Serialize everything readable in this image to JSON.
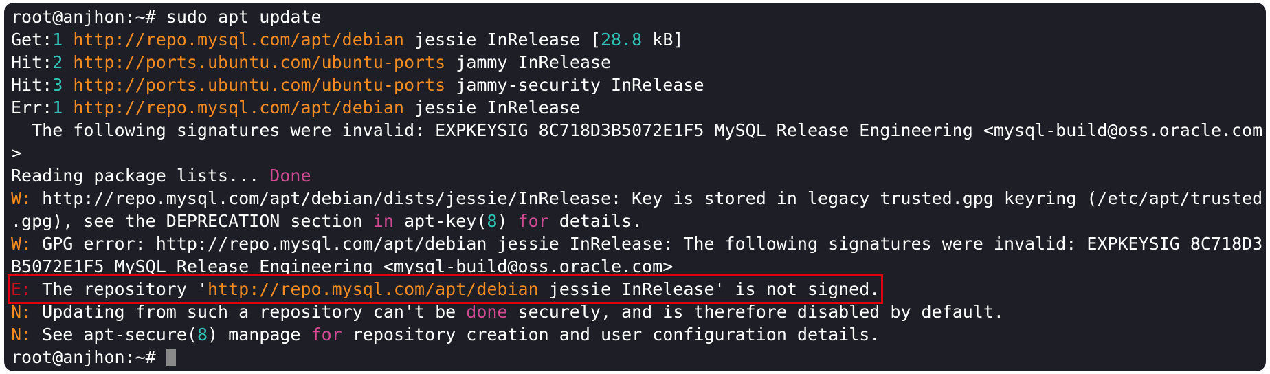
{
  "terminal": {
    "prompt": "root@anjhon:~#",
    "command": "sudo apt update",
    "get1": {
      "label": "Get:",
      "num": "1",
      "url": "http://repo.mysql.com/apt/debian",
      "suite": "jessie InRelease",
      "size_open": "[",
      "size_num": "28.8",
      "size_close": "kB]"
    },
    "hit2": {
      "label": "Hit:",
      "num": "2",
      "url": "http://ports.ubuntu.com/ubuntu-ports",
      "suite": "jammy InRelease"
    },
    "hit3": {
      "label": "Hit:",
      "num": "3",
      "url": "http://ports.ubuntu.com/ubuntu-ports",
      "suite": "jammy-security InRelease"
    },
    "err1": {
      "label": "Err:",
      "num": "1",
      "url": "http://repo.mysql.com/apt/debian",
      "suite": "jessie InRelease"
    },
    "sig_line1": "  The following signatures were invalid: EXPKEYSIG 8C718D3B5072E1F5 MySQL Release Engineering <mysql-build@oss.oracle.com",
    "sig_line2": ">",
    "reading": {
      "text": "Reading package lists... ",
      "done": "Done"
    },
    "w1": {
      "prefix": "W:",
      "line1": "http://repo.mysql.com/apt/debian/dists/jessie/InRelease: Key is stored in legacy trusted.gpg keyring (/etc/apt/trusted",
      "line2_a": ".gpg), see the DEPRECATION section ",
      "line2_in": "in",
      "line2_b": " apt-key(",
      "line2_num": "8",
      "line2_c": ") ",
      "line2_for": "for",
      "line2_d": " details."
    },
    "w2": {
      "prefix": "W:",
      "line1": "GPG error: http://repo.mysql.com/apt/debian jessie InRelease: The following signatures were invalid: EXPKEYSIG 8C718D3",
      "line2": "B5072E1F5 MySQL Release Engineering <mysql-build@oss.oracle.com>"
    },
    "e1": {
      "prefix": "E:",
      "text_a": "The repository '",
      "url": "http://repo.mysql.com/apt/debian",
      "text_b": " jessie InRelease' is not signed."
    },
    "n1": {
      "prefix": "N:",
      "text_a": "Updating from such a repository can't be ",
      "done": "done",
      "text_b": " securely, and is therefore disabled by default."
    },
    "n2": {
      "prefix": "N:",
      "text_a": "See apt-secure(",
      "num": "8",
      "text_b": ") manpage ",
      "for": "for",
      "text_c": " repository creation and user configuration details."
    },
    "final_prompt": "root@anjhon:~#"
  },
  "colors": {
    "background": "#1e1e26",
    "text": "#ffffff",
    "number": "#2ec5b6",
    "url": "#f28b22",
    "keyword": "#d04a92",
    "error": "#c8101a",
    "highlight_box": "#e0000f"
  }
}
